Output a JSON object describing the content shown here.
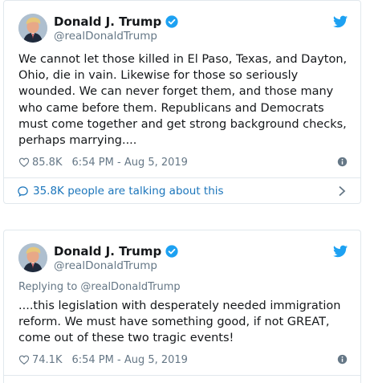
{
  "colors": {
    "text": "#14171a",
    "secondary": "#657786",
    "link": "#1b75bb",
    "twitter_blue": "#1da1f2",
    "border": "#e1e8ed"
  },
  "tweets": [
    {
      "author_name": "Donald J. Trump",
      "author_handle": "@realDonaldTrump",
      "reply_to": "",
      "text": "We cannot let those killed in El Paso, Texas, and Dayton, Ohio, die in vain. Likewise for those so seriously wounded. We can never forget them, and those many who came before them. Republicans and Democrats must come together and get strong background checks, perhaps marrying....",
      "likes": "85.8K",
      "timestamp": "6:54 PM - Aug 5, 2019",
      "talking": "35.8K people are talking about this"
    },
    {
      "author_name": "Donald J. Trump",
      "author_handle": "@realDonaldTrump",
      "reply_to": "Replying to @realDonaldTrump",
      "text": "....this legislation with desperately needed immigration reform. We must have something good, if not GREAT, come out of these two tragic events!",
      "likes": "74.1K",
      "timestamp": "6:54 PM - Aug 5, 2019"
    }
  ],
  "icons": {
    "verified": "verified-badge-icon",
    "bird": "twitter-bird-icon",
    "like": "heart-icon",
    "info": "info-icon",
    "reply": "comment-bubble-icon",
    "chevron": "chevron-right-icon"
  }
}
